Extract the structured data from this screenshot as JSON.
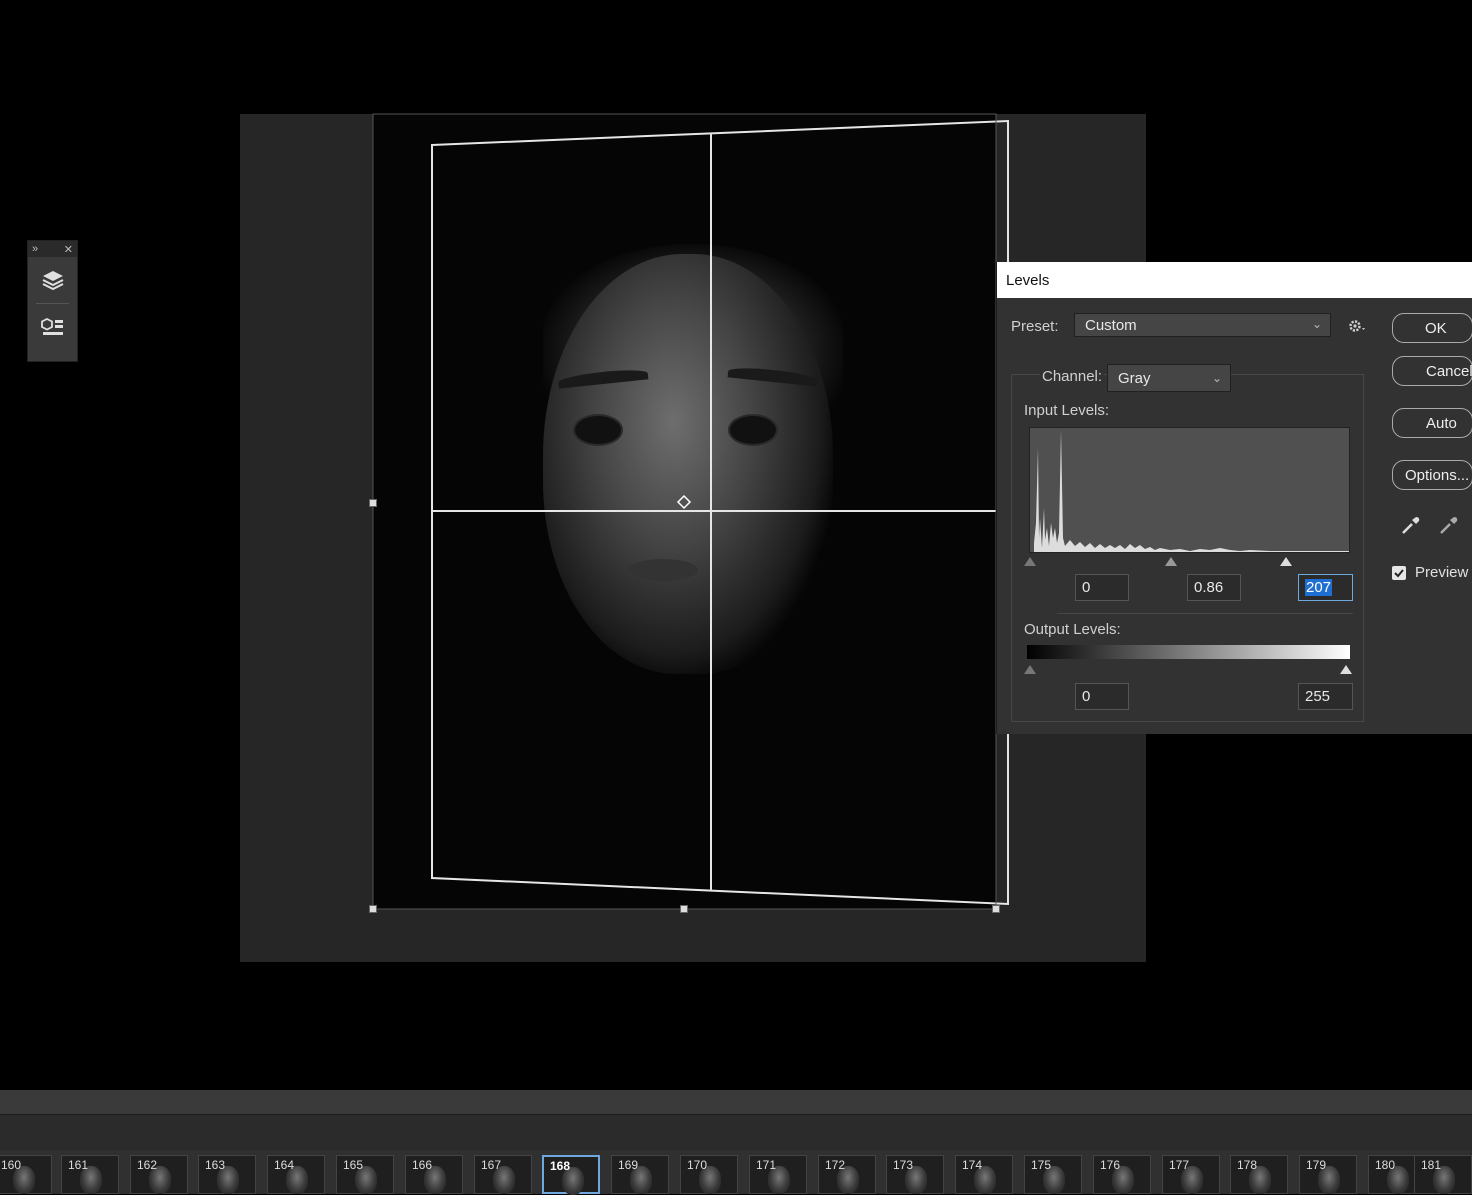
{
  "levels_dialog": {
    "title": "Levels",
    "preset_label": "Preset:",
    "preset_value": "Custom",
    "channel_label": "Channel:",
    "channel_value": "Gray",
    "input_levels_label": "Input Levels:",
    "input_black": "0",
    "input_gamma": "0.86",
    "input_white": "207",
    "output_levels_label": "Output Levels:",
    "output_black": "0",
    "output_white": "255",
    "buttons": {
      "ok": "OK",
      "cancel": "Cancel",
      "auto": "Auto",
      "options": "Options..."
    },
    "preview_label": "Preview",
    "preview_checked": true,
    "input_slider_levels": {
      "black": 0,
      "gamma": 0.86,
      "white": 207
    },
    "output_slider_levels": {
      "black": 0,
      "white": 255
    }
  },
  "mini_panel": {
    "icons": [
      "expand-icon",
      "close-icon",
      "layers-icon",
      "properties-icon"
    ]
  },
  "timeline": {
    "selected_frame": "168",
    "frames": [
      "160",
      "161",
      "162",
      "163",
      "164",
      "165",
      "166",
      "167",
      "168",
      "169",
      "170",
      "171",
      "172",
      "173",
      "174",
      "175",
      "176",
      "177",
      "178",
      "179",
      "180",
      "181"
    ]
  },
  "colors": {
    "dialog_bg": "#323232",
    "accent": "#1e6fd1",
    "canvas_bg": "#262626"
  }
}
